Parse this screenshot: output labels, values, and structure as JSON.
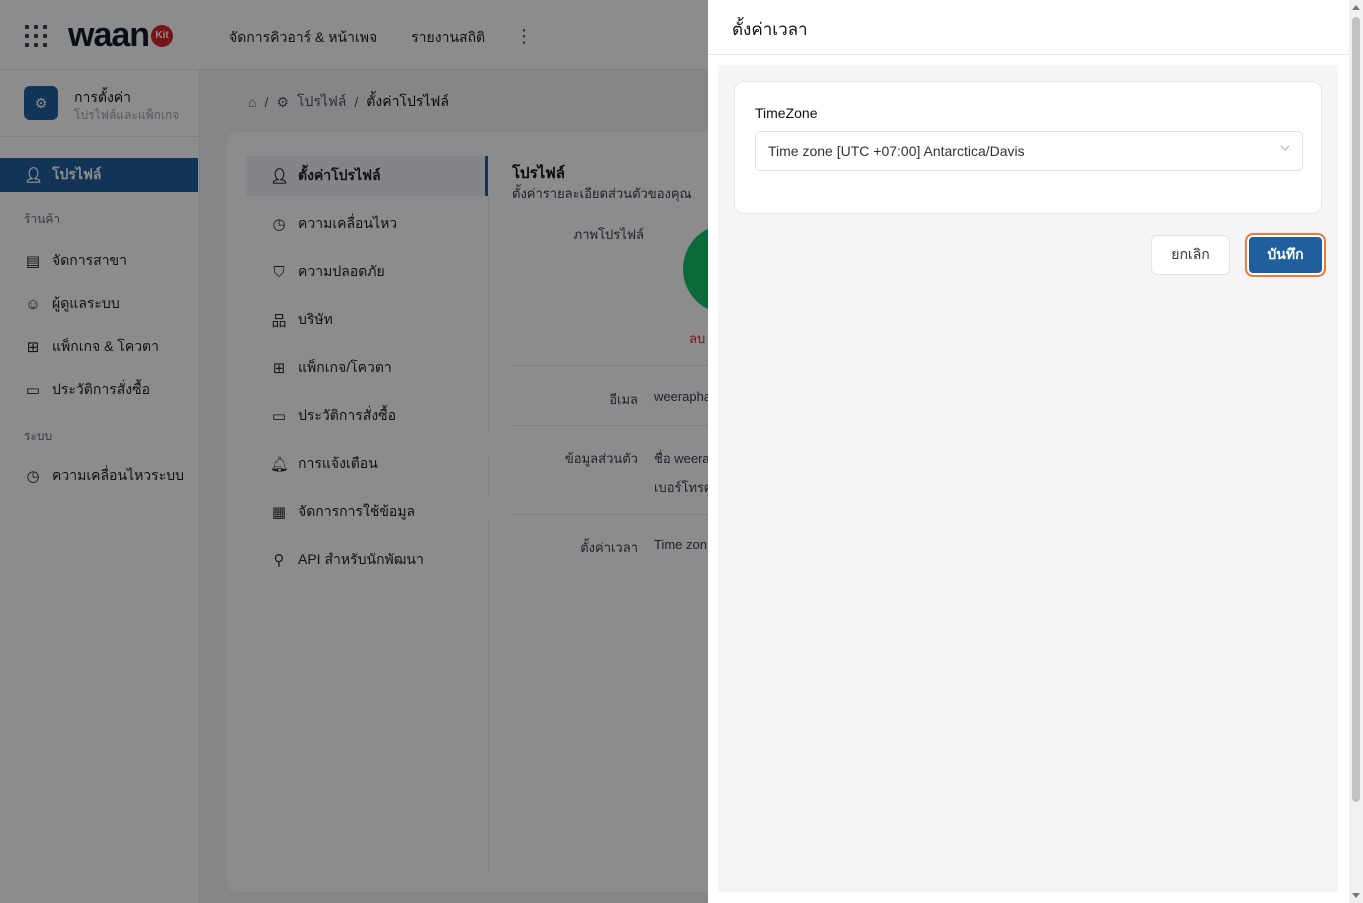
{
  "app": {
    "logo_text": "waan",
    "logo_badge": "Kit",
    "nav": [
      "จัดการคิวอาร์ & หน้าเพจ",
      "รายงานสถิติ"
    ]
  },
  "sidebar": {
    "header_title": "การตั้งค่า",
    "header_subtitle": "โปรไฟล์และแพ็กเกจ",
    "active_item": "โปรไฟล์",
    "section_shop": "ร้านค้า",
    "shop_items": [
      "จัดการสาขา",
      "ผู้ดูแลระบบ",
      "แพ็กเกจ & โควตา",
      "ประวัติการสั่งซื้อ"
    ],
    "section_system": "ระบบ",
    "system_items": [
      "ความเคลื่อนไหวระบบ"
    ]
  },
  "breadcrumb": {
    "profile": "โปรไฟล์",
    "current": "ตั้งค่าโปรไฟล์"
  },
  "profile_menu": [
    "ตั้งค่าโปรไฟล์",
    "ความเคลื่อนไหว",
    "ความปลอดภัย",
    "บริษัท",
    "แพ็กเกจ/โควตา",
    "ประวัติการสั่งซื้อ",
    "การแจ้งเตือน",
    "จัดการการใช้ข้อมูล",
    "API สำหรับนักพัฒนา"
  ],
  "profile": {
    "title": "โปรไฟล์",
    "subtitle": "ตั้งค่ารายละเอียดส่วนตัวของคุณ",
    "photo_label": "ภาพโปรไฟล์",
    "delete_label": "ลบ",
    "email_label": "อีเมล",
    "email_value": "weerapha",
    "personal_label": "ข้อมูลส่วนตัว",
    "name_value": "ชื่อ weera",
    "phone_value": "เบอร์โทรศ",
    "time_label": "ตั้งค่าเวลา",
    "time_value": "Time zon"
  },
  "drawer": {
    "title": "ตั้งค่าเวลา",
    "timezone_label": "TimeZone",
    "timezone_value": "Time zone [UTC +07:00] Antarctica/Davis",
    "cancel_label": "ยกเลิก",
    "save_label": "บันทึก"
  },
  "colors": {
    "primary": "#1f5f9e",
    "focus_ring": "#ef7a3d",
    "avatar": "#17c06a",
    "danger": "#d9252b"
  }
}
